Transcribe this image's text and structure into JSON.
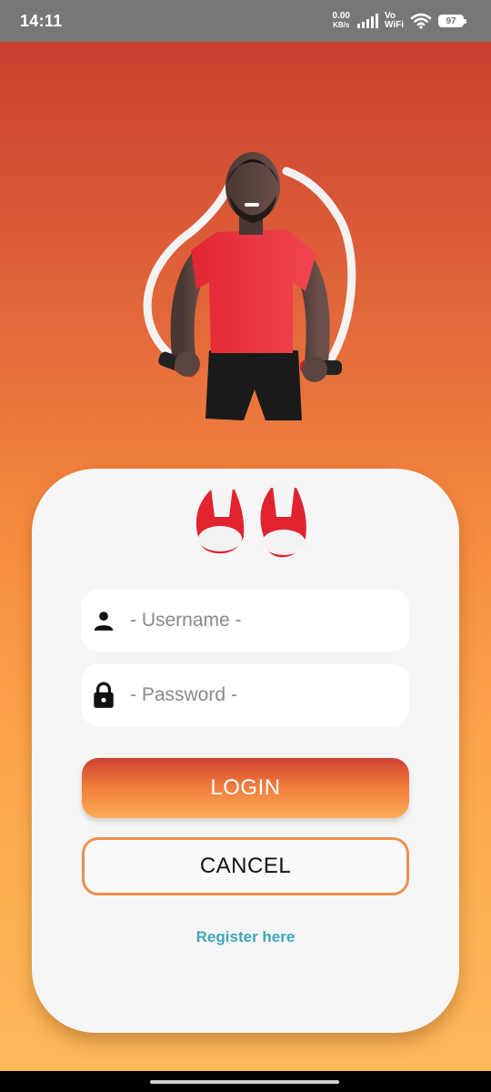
{
  "status_bar": {
    "time": "14:11",
    "net_speed_value": "0.00",
    "net_speed_unit": "KB/s",
    "volte_line1": "Vo",
    "volte_line2": "WiFi",
    "battery": "97"
  },
  "login_form": {
    "username_placeholder": "- Username -",
    "password_placeholder": "- Password -",
    "login_label": "LOGIN",
    "cancel_label": "CANCEL",
    "register_label": "Register here"
  },
  "icons": {
    "username": "person-icon",
    "password": "lock-icon",
    "hero": "jump-rope-character-illustration"
  },
  "colors": {
    "gradient_top": "#c9402f",
    "gradient_bottom": "#fdb95a",
    "card": "#f6f6f6",
    "cancel_border": "#ef8f4f",
    "register_link": "#3fa7b9"
  }
}
